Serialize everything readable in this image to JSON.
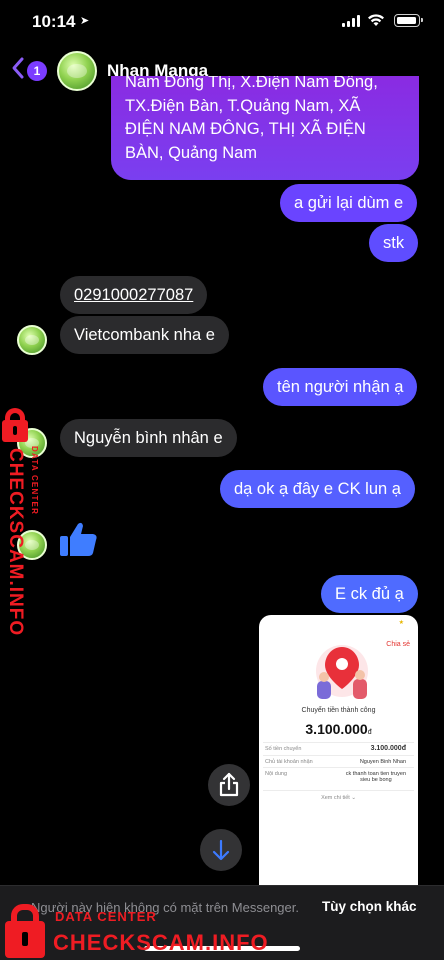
{
  "status_bar": {
    "time": "10:14"
  },
  "header": {
    "unread_count": "1",
    "contact_name": "Nhan Manga"
  },
  "messages": {
    "address_line_cut": "Nam Đông Thị, X.Điện Nam Đông,",
    "address_line_1": "TX.Điện Bàn, T.Quảng Nam, XÃ",
    "address_line_2": "ĐIỆN NAM ĐÔNG, THỊ XÃ ĐIỆN",
    "address_line_3": "BÀN, Quảng Nam",
    "resend": "a gửi lại dùm e",
    "stk": "stk",
    "account_number": "0291000277087",
    "bank": "Vietcombank nha e",
    "ask_name": "tên người nhận ạ",
    "name_reply": "Nguyễn bình nhân e",
    "transfer_done": "dạ ok ạ đây e CK lun ạ",
    "paid_full": "E ck đủ ạ"
  },
  "receipt": {
    "share_label": "Chia sẻ",
    "title": "Chuyển tiền thành công",
    "amount": "3.100.000",
    "currency": "đ",
    "row1_label": "Số tiền chuyển",
    "row1_value": "3.100.000",
    "row1_currency": "đ",
    "row2_label": "Chủ tài khoản nhận",
    "row2_value": "Nguyen Binh Nhan",
    "row3_label": "Nội dung",
    "row3_value_1": "ck thanh toan tien truyen",
    "row3_value_2": "sieu be bong",
    "more_label": "Xem chi tiết ⌄"
  },
  "bottom_bar": {
    "notice": "Người này hiện không có mặt trên Messenger.",
    "more_options": "Tùy chọn khác"
  },
  "watermark": {
    "data_center": "DATA CENTER",
    "site": "CHECKSCAM.INFO",
    "color": "#ef1c23"
  },
  "colors": {
    "outgoing_top": "#8a2be2",
    "outgoing_bottom": "#4f6bff",
    "incoming": "#2b2b2d",
    "background": "#000000"
  }
}
